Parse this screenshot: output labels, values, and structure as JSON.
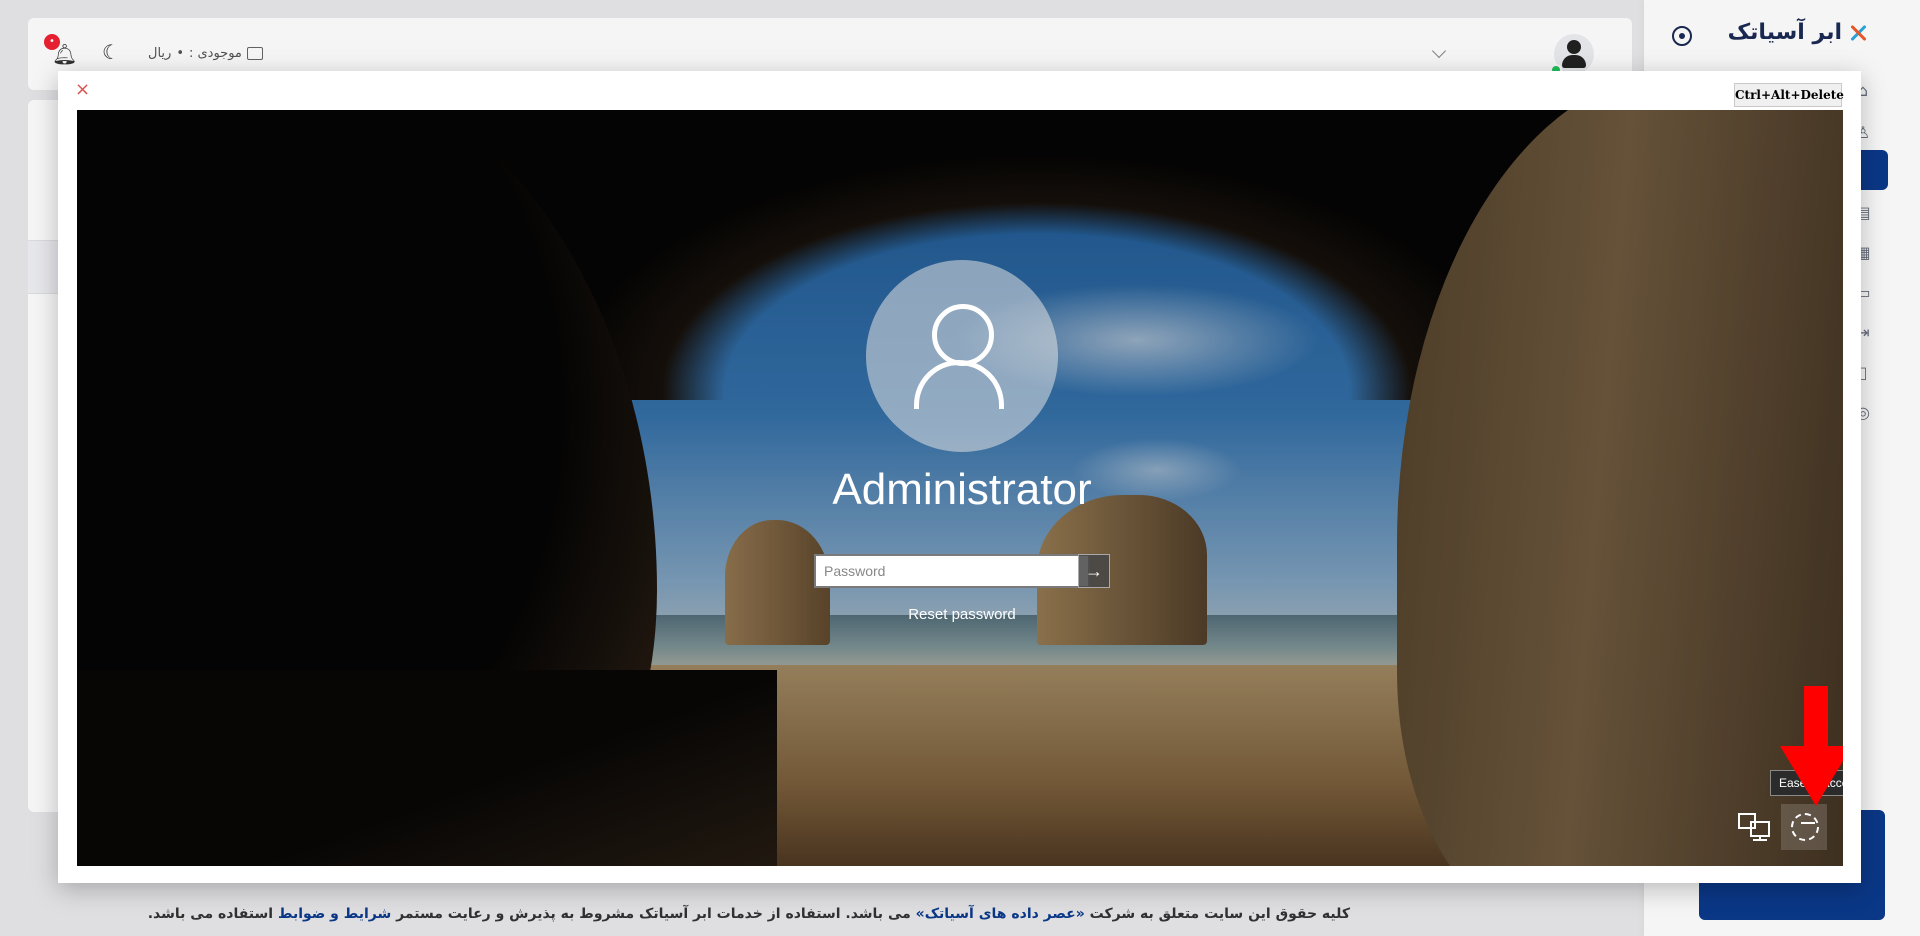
{
  "sidebar": {
    "brand_name": "ابر آسیاتک",
    "brand_icon": "asiatech-logo",
    "nav_icons": [
      "home-icon",
      "user-icon",
      "cloud-icon",
      "server-icon",
      "grid-icon",
      "document-icon",
      "transfer-icon",
      "book-icon",
      "support-icon"
    ],
    "active_index": 2,
    "accent": "#0b3a8c"
  },
  "header": {
    "balance_label": "موجودی :",
    "balance_value": "•",
    "balance_currency": "ریال",
    "notification_count": "•"
  },
  "modal": {
    "close_label": "×",
    "cad_button_label": "Ctrl+Alt+Delete"
  },
  "login_screen": {
    "username": "Administrator",
    "password_placeholder": "Password",
    "submit_icon": "arrow-right-icon",
    "reset_link": "Reset password",
    "tooltip": "Ease of access",
    "network_icon": "network-icon",
    "ease_icon": "ease-of-access-icon"
  },
  "annotation": {
    "arrow_color": "#ff0000"
  },
  "footer": {
    "part1": "کلیه حقوق این سایت متعلق به شرکت ",
    "company": "«عصر داده های آسیاتک»",
    "part2": " می باشد. استفاده از خدمات ابر آسیاتک مشروط به پذیرش و رعایت مستمر ",
    "terms_link": "شرایط و ضوابط",
    "part3": " استفاده می باشد."
  }
}
